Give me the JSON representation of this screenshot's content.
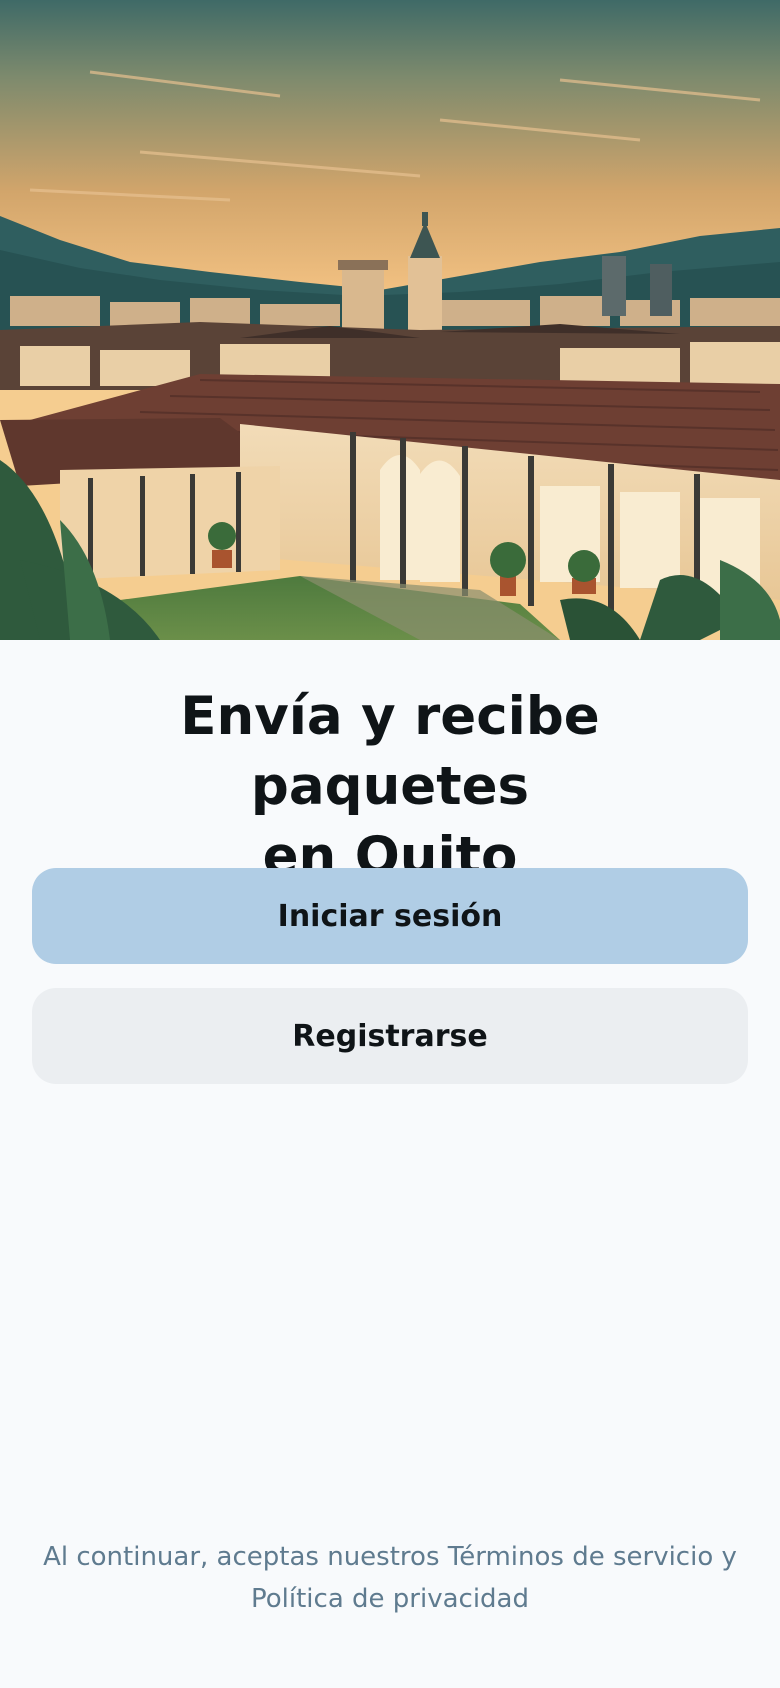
{
  "hero": {
    "image_subject": "quito-colonial-city-illustration"
  },
  "headline": {
    "line1": "Envía y recibe paquetes",
    "line2": "en Quito"
  },
  "actions": {
    "login_label": "Iniciar sesión",
    "register_label": "Registrarse"
  },
  "legal": {
    "prefix": "Al continuar, aceptas nuestros ",
    "terms_link": "Términos de servicio",
    "conjunction": " y ",
    "privacy_link": "Política de privacidad"
  },
  "colors": {
    "background": "#f8fafc",
    "primary_button": "#b0cde5",
    "secondary_button": "#ebeef1",
    "text": "#0f1417",
    "muted_text": "#5f7b8f"
  }
}
